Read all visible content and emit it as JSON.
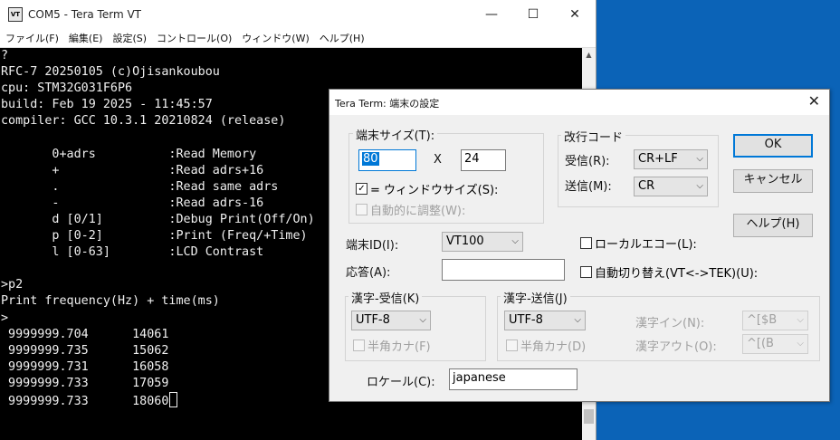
{
  "main_window": {
    "icon_text": "VT",
    "title": "COM5 - Tera Term VT",
    "controls": {
      "minimize": "—",
      "maximize": "☐",
      "close": "✕"
    },
    "menu": [
      "ファイル(F)",
      "編集(E)",
      "設定(S)",
      "コントロール(O)",
      "ウィンドウ(W)",
      "ヘルプ(H)"
    ]
  },
  "terminal": {
    "lines": [
      "?",
      "RFC-7 20250105 (c)Ojisankoubou",
      "cpu: STM32G031F6P6",
      "build: Feb 19 2025 - 11:45:57",
      "compiler: GCC 10.3.1 20210824 (release)",
      "",
      "       0+adrs          :Read Memory",
      "       +               :Read adrs+16",
      "       .               :Read same adrs",
      "       -               :Read adrs-16",
      "       d [0/1]         :Debug Print(Off/On)",
      "       p [0-2]         :Print (Freq/+Time)",
      "       l [0-63]        :LCD Contrast",
      "",
      ">p2",
      "Print frequency(Hz) + time(ms)",
      ">",
      " 9999999.704      14061",
      " 9999999.735      15062",
      " 9999999.731      16058",
      " 9999999.733      17059",
      " 9999999.733      18060"
    ]
  },
  "dialog": {
    "title": "Tera Term: 端末の設定",
    "close": "✕",
    "terminal_size": {
      "label": "端末サイズ(T):",
      "cols": "80",
      "x_sep": "X",
      "rows": "24",
      "window_size_label": "= ウィンドウサイズ(S):",
      "window_size_checked": true,
      "auto_adjust_label": "自動的に調整(W):",
      "auto_adjust_checked": false
    },
    "newline": {
      "label": "改行コード",
      "receive_label": "受信(R):",
      "receive_value": "CR+LF",
      "send_label": "送信(M):",
      "send_value": "CR"
    },
    "buttons": {
      "ok": "OK",
      "cancel": "キャンセル",
      "help": "ヘルプ(H)"
    },
    "terminal_id": {
      "label": "端末ID(I):",
      "value": "VT100"
    },
    "local_echo": {
      "label": "ローカルエコー(L):",
      "checked": false
    },
    "answerback": {
      "label": "応答(A):",
      "value": ""
    },
    "auto_switch": {
      "label": "自動切り替え(VT<->TEK)(U):",
      "checked": false
    },
    "kanji_receive": {
      "label": "漢字-受信(K)",
      "value": "UTF-8",
      "halfwidth_label": "半角カナ(F)"
    },
    "kanji_send": {
      "label": "漢字-送信(J)",
      "value": "UTF-8",
      "halfwidth_label": "半角カナ(D)",
      "kanji_in_label": "漢字イン(N):",
      "kanji_in_value": "^[$B",
      "kanji_out_label": "漢字アウト(O):",
      "kanji_out_value": "^[(B"
    },
    "locale": {
      "label": "ロケール(C):",
      "value": "japanese"
    }
  }
}
